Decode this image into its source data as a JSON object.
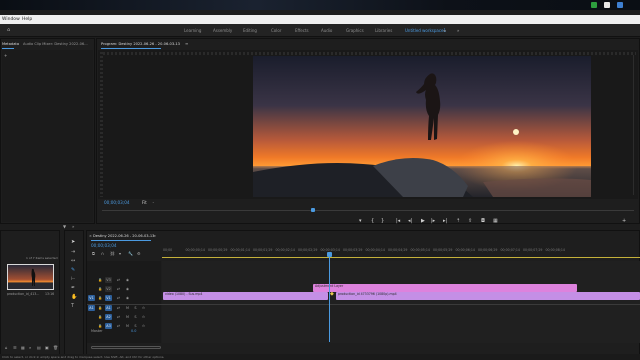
{
  "menu": {
    "items": [
      "Window",
      "Help"
    ]
  },
  "workspaces": {
    "tabs": [
      {
        "label": "Learning"
      },
      {
        "label": "Assembly"
      },
      {
        "label": "Editing"
      },
      {
        "label": "Color"
      },
      {
        "label": "Effects"
      },
      {
        "label": "Audio"
      },
      {
        "label": "Graphics"
      },
      {
        "label": "Libraries"
      },
      {
        "label": "Untitled workspace1"
      }
    ],
    "active_index": 8
  },
  "source_panel": {
    "tabs": [
      "Metadata",
      "Audio Clip Mixer: Destiny 2022-06..."
    ]
  },
  "program_monitor": {
    "title": "Program: Destiny 2022-06-26 - 20-06-03-13",
    "timecode": "00;00;03;04",
    "fit": "Fit"
  },
  "project_panel": {
    "items_selected": "1 of 7 items selected",
    "clip_name": "production_id_413...",
    "clip_duration": "13:16"
  },
  "timeline": {
    "sequence_tab": "Destiny 2022-06-26 - 20-06-03-13",
    "timecode": "00;00;03;04",
    "ruler": [
      "00;00",
      "00;00;00;14",
      "00;00;00;29",
      "00;00;01;14",
      "00;00;01;29",
      "00;00;02;14",
      "00;00;02;29",
      "00;00;03;14",
      "00;00;03;29",
      "00;00;04;14",
      "00;00;04;29",
      "00;00;05;14",
      "00;00;05;29",
      "00;00;06;14",
      "00;00;06;29",
      "00;00;07;14",
      "00;00;07;29",
      "00;00;08;14"
    ],
    "tracks": [
      "V3",
      "V2",
      "V1",
      "A1",
      "A2",
      "A3"
    ],
    "source_patch": [
      "V1",
      "A1"
    ],
    "master_label": "Master",
    "master_value": "0.0",
    "clips": [
      {
        "label": "Adjustment Layer",
        "track": "V2",
        "color": "#dd82dd"
      },
      {
        "label": "video (1080) - Sus.mp4",
        "track": "V1",
        "color": "#c48fe6"
      },
      {
        "label": "production_id 4733796 (1080p).mp4",
        "track": "V1",
        "color": "#c48fe6"
      }
    ]
  },
  "status": {
    "text": "Click to select, or click in empty space and drag to marquee select. Use Shift, Alt, and Ctrl for other options."
  },
  "colors": {
    "accent": "#4b9ae0",
    "clip_video": "#c48fe6",
    "clip_adjust": "#dd82dd",
    "playhead": "#4b9ae0"
  }
}
